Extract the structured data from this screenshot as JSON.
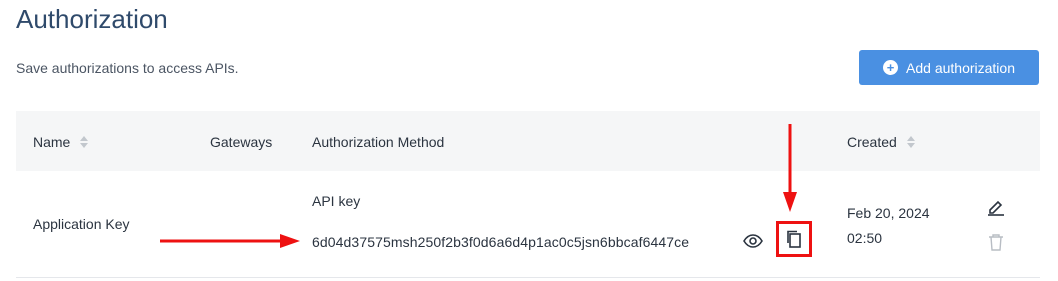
{
  "page": {
    "title": "Authorization",
    "subtitle": "Save authorizations to access APIs.",
    "add_button_label": "Add authorization"
  },
  "table": {
    "columns": [
      "Name",
      "Gateways",
      "Authorization Method",
      "Created"
    ],
    "rows": [
      {
        "name": "Application Key",
        "gateways": "",
        "method_type": "API key",
        "method_value": "6d04d37575msh250f2b3f0d6a6d4p1ac0c5jsn6bbcaf6447ce",
        "created_date": "Feb 20, 2024",
        "created_time": "02:50"
      }
    ]
  },
  "icons": {
    "add": "plus-circle-icon",
    "sort": "sort-icon",
    "reveal": "eye-icon",
    "copy": "copy-icon",
    "edit": "pencil-icon",
    "delete": "trash-icon"
  },
  "colors": {
    "primary": "#4a90e2",
    "title": "#2f4a6b",
    "annotation": "#ee1111",
    "header_bg": "#f5f6f7"
  }
}
